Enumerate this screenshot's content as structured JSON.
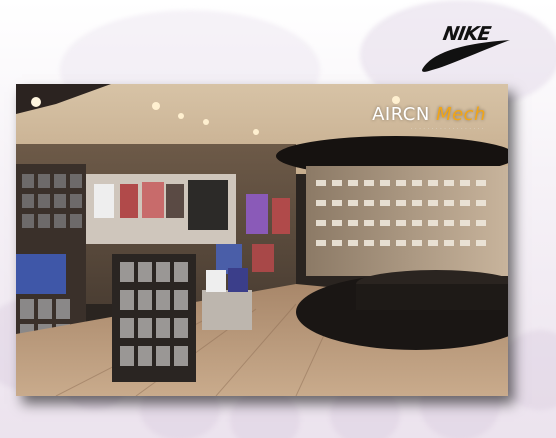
{
  "brand": {
    "logo_text": "NIKE"
  },
  "photo": {
    "subject": "retail-store-interior",
    "watermark": {
      "part1": "AIRC",
      "part2": "N",
      "part3": " Mech"
    }
  },
  "colors": {
    "accent": "#f2a515",
    "logo": "#111111",
    "background": "#f3eef4"
  }
}
